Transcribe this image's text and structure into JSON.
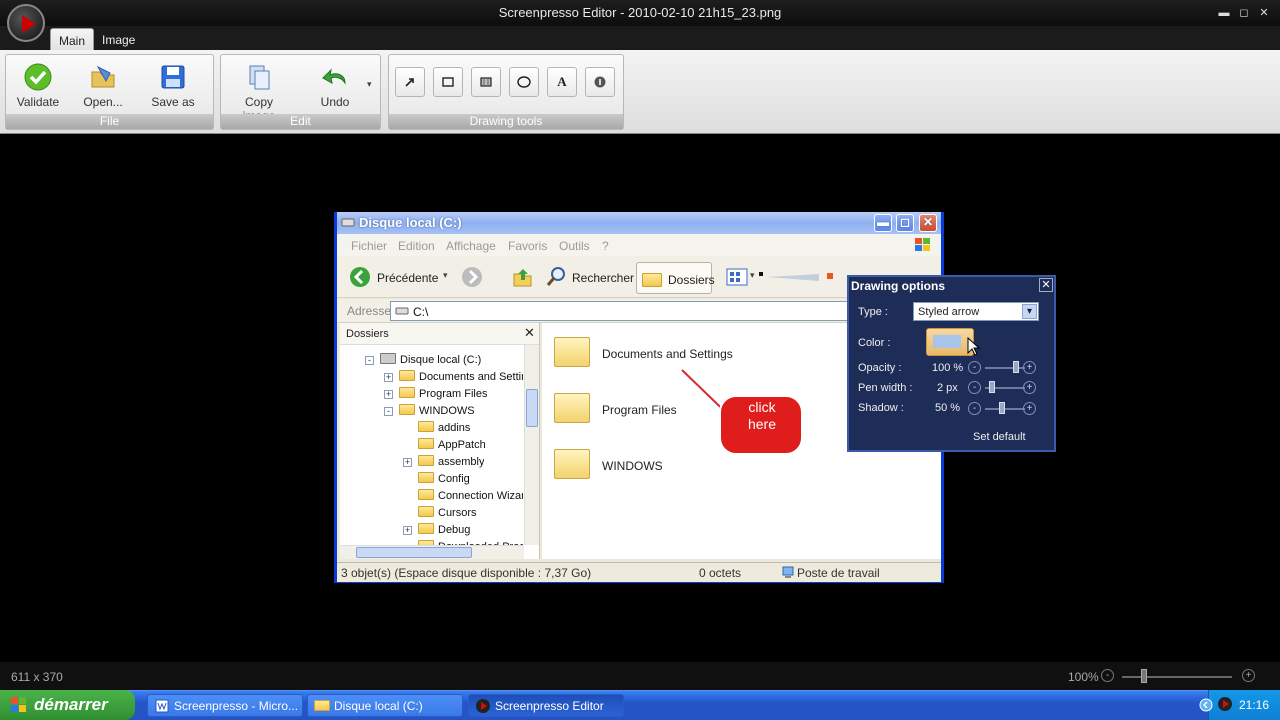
{
  "app": {
    "title": "Screenpresso Editor  -  2010-02-10 21h15_23.png",
    "tabs": [
      "Main",
      "Image"
    ]
  },
  "ribbon": {
    "file": {
      "label": "File",
      "validate": "Validate",
      "open": "Open...",
      "save_as": "Save as"
    },
    "edit": {
      "label": "Edit",
      "copy_image": "Copy image",
      "undo": "Undo"
    },
    "drawing_tools": {
      "label": "Drawing tools",
      "tools": [
        "arrow-icon",
        "rectangle-icon",
        "blur-icon",
        "ellipse-icon",
        "text-icon",
        "counter-icon"
      ],
      "text_tool_glyph": "A"
    }
  },
  "explorer": {
    "title": "Disque local (C:)",
    "menu": [
      "Fichier",
      "Edition",
      "Affichage",
      "Favoris",
      "Outils",
      "?"
    ],
    "back_label": "Précédente",
    "search_label": "Rechercher",
    "folders_label": "Dossiers",
    "address_label": "Adresse",
    "address_value": "C:\\",
    "pane_title": "Dossiers",
    "tree": [
      {
        "label": "Disque local (C:)",
        "level": 0,
        "expander": "-"
      },
      {
        "label": "Documents and Settir",
        "level": 1,
        "expander": "+"
      },
      {
        "label": "Program Files",
        "level": 1,
        "expander": "+"
      },
      {
        "label": "WINDOWS",
        "level": 1,
        "expander": "-"
      },
      {
        "label": "addins",
        "level": 2,
        "expander": ""
      },
      {
        "label": "AppPatch",
        "level": 2,
        "expander": ""
      },
      {
        "label": "assembly",
        "level": 2,
        "expander": "+"
      },
      {
        "label": "Config",
        "level": 2,
        "expander": ""
      },
      {
        "label": "Connection Wizar",
        "level": 2,
        "expander": ""
      },
      {
        "label": "Cursors",
        "level": 2,
        "expander": ""
      },
      {
        "label": "Debug",
        "level": 2,
        "expander": "+"
      },
      {
        "label": "Downloaded Prog",
        "level": 2,
        "expander": ""
      }
    ],
    "folders": [
      "Documents and Settings",
      "Program Files",
      "WINDOWS"
    ],
    "callout": "click\nhere",
    "status": {
      "objects": "3 objet(s) (Espace disque disponible : 7,37 Go)",
      "size": "0 octets",
      "location": "Poste de travail"
    }
  },
  "drawing_options": {
    "title": "Drawing options",
    "type_label": "Type :",
    "type_value": "Styled arrow",
    "color_label": "Color :",
    "opacity_label": "Opacity :",
    "opacity_value": "100 %",
    "pen_label": "Pen width :",
    "pen_value": "2 px",
    "shadow_label": "Shadow :",
    "shadow_value": "50 %",
    "set_default": "Set default",
    "minus_glyph": "-",
    "plus_glyph": "+",
    "close_glyph": "✕",
    "dropdown_glyph": "▾"
  },
  "statusbar": {
    "dimensions": "611 x 370",
    "zoom": "100%",
    "minus_glyph": "-",
    "plus_glyph": "+"
  },
  "taskbar": {
    "start": "démarrer",
    "tasks": [
      "Screenpresso - Micro...",
      "Disque local (C:)",
      "Screenpresso Editor"
    ],
    "clock": "21:16"
  },
  "window_controls": {
    "minimize": "▬",
    "maximize": "◻",
    "close": "✕"
  }
}
